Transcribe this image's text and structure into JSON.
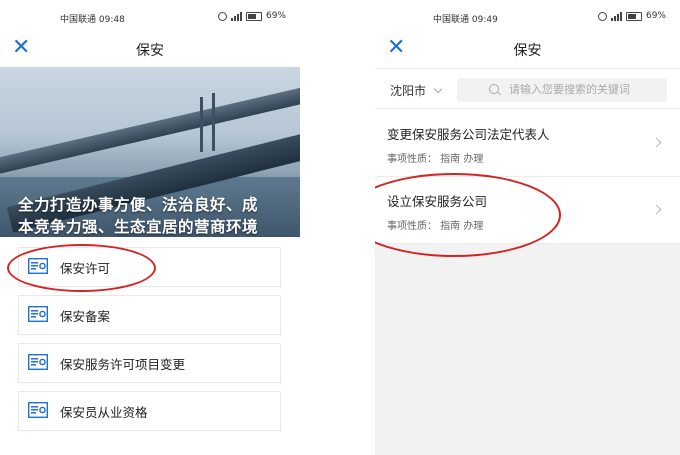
{
  "left_screen": {
    "status": {
      "carrier_time": "中国联通 09:48",
      "battery": "69%"
    },
    "nav": {
      "title": "保安",
      "close_glyph": "✕"
    },
    "banner": {
      "line1": "全力打造办事方便、法治良好、成",
      "line2": "本竞争力强、生态宜居的营商环境"
    },
    "menu": [
      {
        "label": "保安许可",
        "icon": "license-card-icon"
      },
      {
        "label": "保安备案",
        "icon": "license-card-icon"
      },
      {
        "label": "保安服务许可项目变更",
        "icon": "license-card-icon"
      },
      {
        "label": "保安员从业资格",
        "icon": "license-card-icon"
      }
    ]
  },
  "right_screen": {
    "status": {
      "carrier_time": "中国联通 09:49",
      "battery": "69%"
    },
    "nav": {
      "title": "保安",
      "close_glyph": "✕"
    },
    "filter": {
      "city": "沈阳市",
      "search_placeholder": "请输入您要搜索的关键词"
    },
    "list": [
      {
        "title": "变更保安服务公司法定代表人",
        "subtitle": "事项性质：  指南  办理"
      },
      {
        "title": "设立保安服务公司",
        "subtitle": "事项性质：  指南  办理"
      }
    ]
  },
  "colors": {
    "accent": "#1e6fd9",
    "highlight": "#d42323"
  }
}
